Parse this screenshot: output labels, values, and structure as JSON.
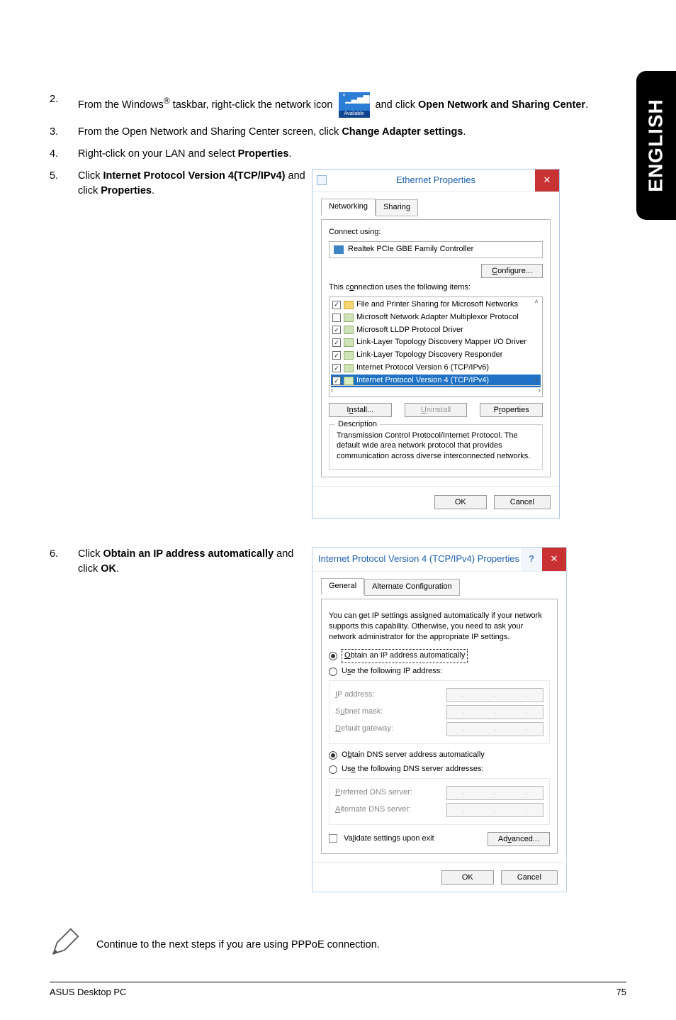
{
  "sideTab": "ENGLISH",
  "steps": {
    "s2_num": "2.",
    "s2_a": "From the Windows",
    "s2_reg": "®",
    "s2_b": " taskbar, right-click the network icon ",
    "s2_c": " and click ",
    "s2_bold1": "Open Network and Sharing Center",
    "s2_d": ".",
    "s3_num": "3.",
    "s3_a": "From the Open Network and Sharing Center screen, click ",
    "s3_bold": "Change Adapter settings",
    "s3_b": ".",
    "s4_num": "4.",
    "s4_a": "Right-click on your LAN and select ",
    "s4_bold": "Properties",
    "s4_b": ".",
    "s5_num": "5.",
    "s5_a": "Click ",
    "s5_bold1": "Internet Protocol Version 4(TCP/IPv4)",
    "s5_b": " and click ",
    "s5_bold2": "Properties",
    "s5_c": ".",
    "s6_num": "6.",
    "s6_a": "Click ",
    "s6_bold1": "Obtain an IP address automatically",
    "s6_b": " and click ",
    "s6_bold2": "OK",
    "s6_c": "."
  },
  "netIcon": {
    "available": "Available"
  },
  "ethDlg": {
    "title": "Ethernet Properties",
    "tabNetworking": "Networking",
    "tabSharing": "Sharing",
    "connectUsing": "Connect using:",
    "adapter": "Realtek PCIe GBE Family Controller",
    "configureBtn": "Configure...",
    "itemsLabel": "This connection uses the following items:",
    "items": [
      {
        "checked": true,
        "iconClass": "ic",
        "label": "File and Printer Sharing for Microsoft Networks"
      },
      {
        "checked": false,
        "iconClass": "ic driver",
        "label": "Microsoft Network Adapter Multiplexor Protocol"
      },
      {
        "checked": true,
        "iconClass": "ic driver",
        "label": "Microsoft LLDP Protocol Driver"
      },
      {
        "checked": true,
        "iconClass": "ic driver",
        "label": "Link-Layer Topology Discovery Mapper I/O Driver"
      },
      {
        "checked": true,
        "iconClass": "ic driver",
        "label": "Link-Layer Topology Discovery Responder"
      },
      {
        "checked": true,
        "iconClass": "ic driver",
        "label": "Internet Protocol Version 6 (TCP/IPv6)"
      },
      {
        "checked": true,
        "iconClass": "ic driver",
        "label": "Internet Protocol Version 4 (TCP/IPv4)",
        "selected": true
      }
    ],
    "installBtn": "Install...",
    "uninstallBtn": "Uninstall",
    "propertiesBtn": "Properties",
    "descTitle": "Description",
    "descText": "Transmission Control Protocol/Internet Protocol. The default wide area network protocol that provides communication across diverse interconnected networks.",
    "okBtn": "OK",
    "cancelBtn": "Cancel"
  },
  "ipDlg": {
    "title": "Internet Protocol Version 4 (TCP/IPv4) Properties",
    "tabGeneral": "General",
    "tabAlt": "Alternate Configuration",
    "info": "You can get IP settings assigned automatically if your network supports this capability. Otherwise, you need to ask your network administrator for the appropriate IP settings.",
    "rAutoIp": "Obtain an IP address automatically",
    "rUseIp": "Use the following IP address:",
    "ipAddress": "IP address:",
    "subnet": "Subnet mask:",
    "gateway": "Default gateway:",
    "rAutoDns": "Obtain DNS server address automatically",
    "rUseDns": "Use the following DNS server addresses:",
    "prefDns": "Preferred DNS server:",
    "altDns": "Alternate DNS server:",
    "validate": "Validate settings upon exit",
    "advancedBtn": "Advanced...",
    "okBtn": "OK",
    "cancelBtn": "Cancel"
  },
  "note": "Continue to the next steps if you are using PPPoE connection.",
  "footer": {
    "left": "ASUS Desktop PC",
    "right": "75"
  }
}
